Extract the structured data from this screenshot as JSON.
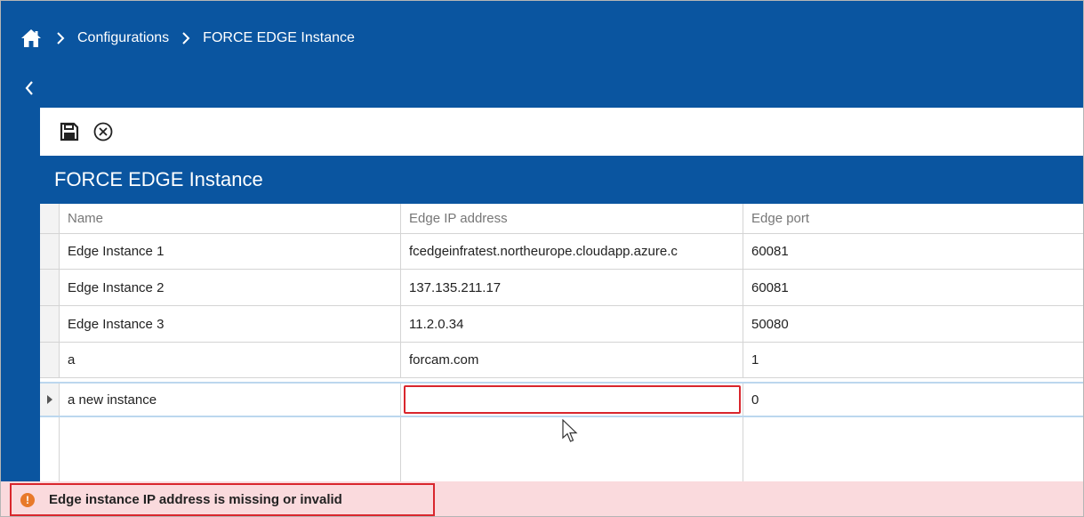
{
  "breadcrumb": {
    "items": [
      "Configurations",
      "FORCE EDGE Instance"
    ]
  },
  "panel": {
    "title": "FORCE EDGE Instance"
  },
  "grid": {
    "columns": [
      "Name",
      "Edge IP address",
      "Edge port"
    ],
    "rows": [
      {
        "name": "Edge Instance 1",
        "ip": "fcedgeinfratest.northeurope.cloudapp.azure.c",
        "port": "60081"
      },
      {
        "name": "Edge Instance 2",
        "ip": "137.135.211.17",
        "port": "60081"
      },
      {
        "name": "Edge Instance 3",
        "ip": "11.2.0.34",
        "port": "50080"
      },
      {
        "name": "a",
        "ip": "forcam.com",
        "port": "1"
      },
      {
        "name": "a new instance",
        "ip": "",
        "port": "0"
      }
    ]
  },
  "error": {
    "message": "Edge instance IP address is missing or invalid"
  },
  "colors": {
    "primary": "#0a55a0",
    "error_border": "#d9262d",
    "error_background": "#fadadd",
    "warning_icon": "#e8792a"
  },
  "icons": {
    "home": "home-icon",
    "separator": "chevron-right-icon",
    "back": "chevron-left-icon",
    "save": "save-icon",
    "cancel": "cancel-circle-icon",
    "row_indicator": "triangle-right-icon",
    "error": "error-icon"
  }
}
